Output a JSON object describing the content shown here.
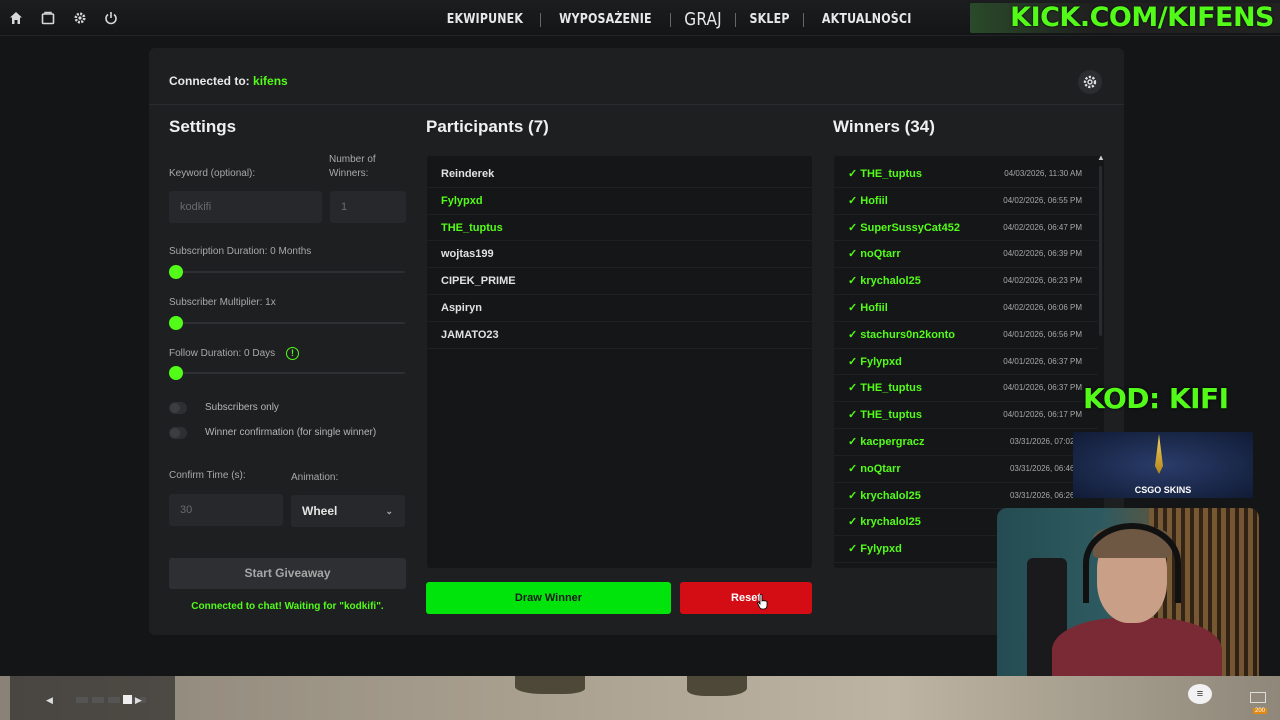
{
  "topbar": {
    "icons": [
      "home-icon",
      "inventory-icon",
      "gear-icon",
      "power-icon"
    ],
    "nav": [
      "EKWIPUNEK",
      "WYPOSAŻENIE",
      "GRAJ",
      "SKLEP",
      "AKTUALNOŚCI"
    ],
    "banner_text": "KICK.COM/KIFENS"
  },
  "header": {
    "connected_label": "Connected to:",
    "channel": "kifens"
  },
  "settings": {
    "title": "Settings",
    "keyword_label": "Keyword (optional):",
    "keyword_placeholder": "kodkifi",
    "winners_label": "Number of Winners:",
    "winners_placeholder": "1",
    "sub_duration_label": "Subscription Duration: 0 Months",
    "sub_duration_value": 0,
    "multiplier_label": "Subscriber Multiplier: 1x",
    "multiplier_value": 0,
    "follow_label": "Follow Duration:",
    "follow_value_text": "0",
    "follow_unit": "Days",
    "follow_value": 0,
    "subs_only_label": "Subscribers only",
    "subs_only": false,
    "confirmation_label": "Winner confirmation (for single winner)",
    "confirmation": false,
    "confirm_time_label": "Confirm Time (s):",
    "confirm_time_placeholder": "30",
    "animation_label": "Animation:",
    "animation_value": "Wheel",
    "start_label": "Start Giveaway",
    "status": "Connected to chat! Waiting for \"kodkifi\"."
  },
  "participants": {
    "title": "Participants (7)",
    "items": [
      {
        "name": "Reinderek",
        "winner": false
      },
      {
        "name": "Fylypxd",
        "winner": true
      },
      {
        "name": "THE_tuptus",
        "winner": true
      },
      {
        "name": "wojtas199",
        "winner": false
      },
      {
        "name": "CIPEK_PRIME",
        "winner": false
      },
      {
        "name": "Aspiryn",
        "winner": false
      },
      {
        "name": "JAMATO23",
        "winner": false
      }
    ]
  },
  "winners": {
    "title": "Winners (34)",
    "items": [
      {
        "name": "✓ THE_tuptus",
        "date": "04/03/2026, 11:30 AM"
      },
      {
        "name": "✓ Hofiil",
        "date": "04/02/2026, 06:55 PM"
      },
      {
        "name": "✓ SuperSussyCat452",
        "date": "04/02/2026, 06:47 PM"
      },
      {
        "name": "✓ noQtarr",
        "date": "04/02/2026, 06:39 PM"
      },
      {
        "name": "✓ krychalol25",
        "date": "04/02/2026, 06:23 PM"
      },
      {
        "name": "✓ Hofiil",
        "date": "04/02/2026, 06:06 PM"
      },
      {
        "name": "✓ stachurs0n2konto",
        "date": "04/01/2026, 06:56 PM"
      },
      {
        "name": "✓ Fylypxd",
        "date": "04/01/2026, 06:37 PM"
      },
      {
        "name": "✓ THE_tuptus",
        "date": "04/01/2026, 06:37 PM"
      },
      {
        "name": "✓ THE_tuptus",
        "date": "04/01/2026, 06:17 PM"
      },
      {
        "name": "✓ kacpergracz",
        "date": "03/31/2026, 07:02 P"
      },
      {
        "name": "✓ noQtarr",
        "date": "03/31/2026, 06:46 P"
      },
      {
        "name": "✓ krychalol25",
        "date": "03/31/2026, 06:26 P"
      },
      {
        "name": "✓ krychalol25",
        "date": ""
      },
      {
        "name": "✓ Fylypxd",
        "date": ""
      }
    ]
  },
  "actions": {
    "draw_label": "Draw Winner",
    "reset_label": "Reset"
  },
  "overlay": {
    "kod_text": "KOD: KIFI",
    "sponsor_text": "CSGO SKINS",
    "mail_count": "200"
  },
  "colors": {
    "accent": "#53fc18",
    "draw": "#00e40b",
    "reset": "#d40d14",
    "panel": "#1e1f21"
  }
}
